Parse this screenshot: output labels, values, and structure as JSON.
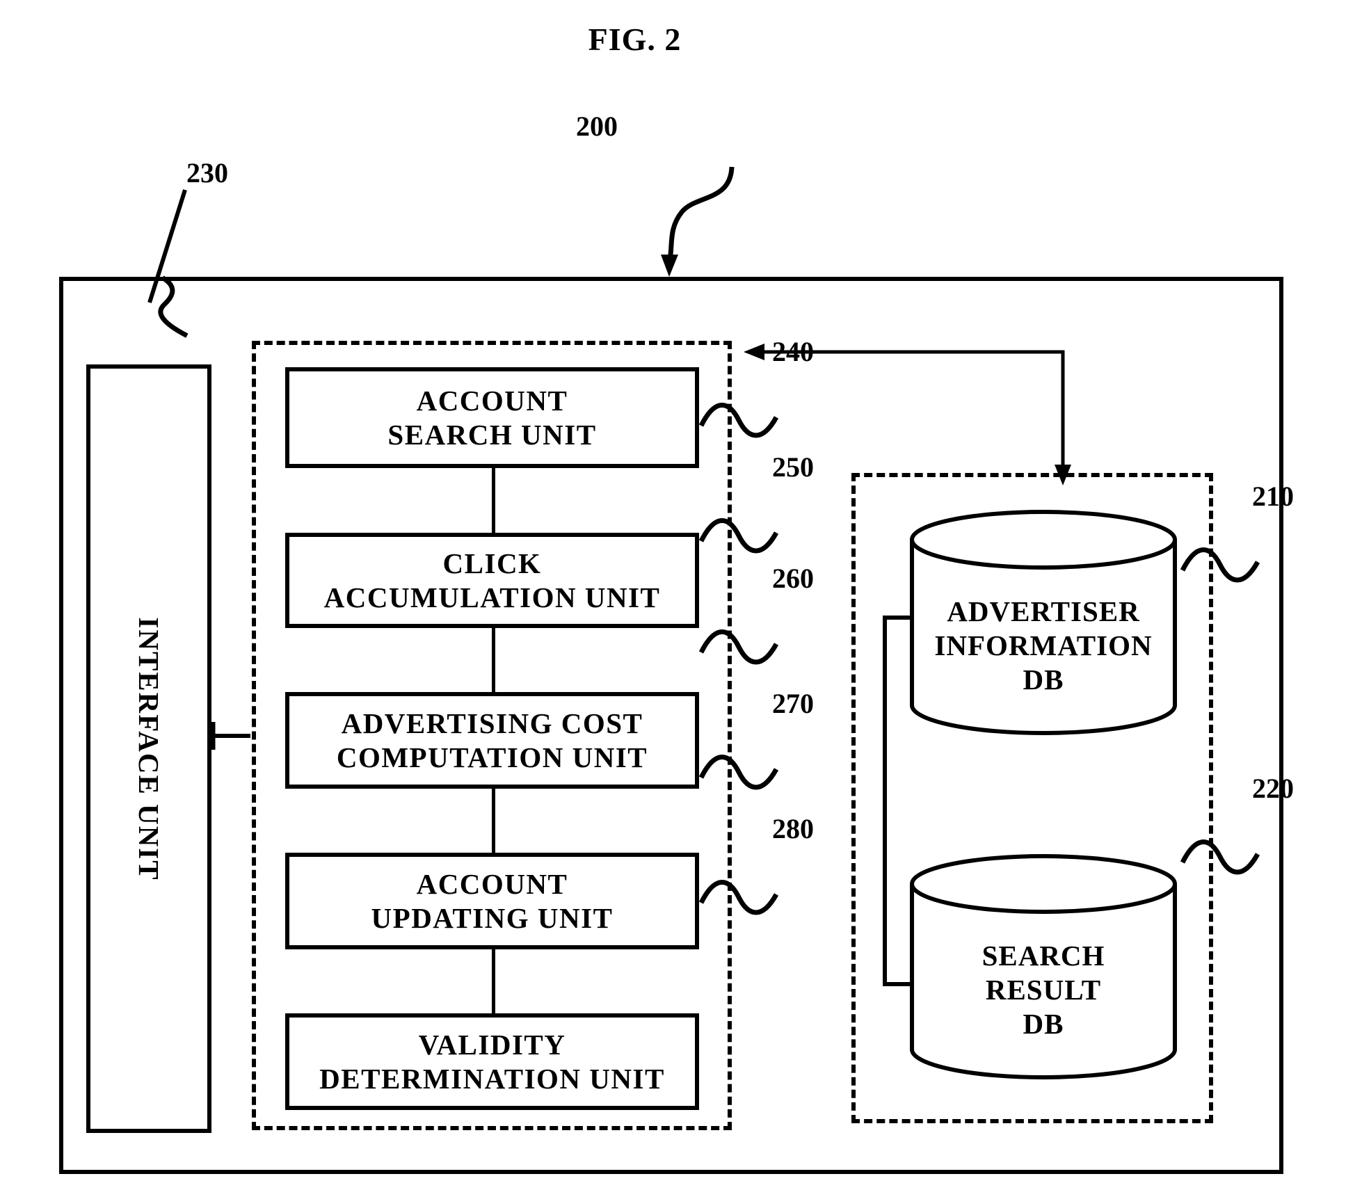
{
  "figure": {
    "title": "FIG. 2",
    "system_ref": "200"
  },
  "interface": {
    "ref": "230",
    "label": "INTERFACE UNIT"
  },
  "processing_units": [
    {
      "ref": "240",
      "lines": [
        "ACCOUNT",
        "SEARCH UNIT"
      ]
    },
    {
      "ref": "250",
      "lines": [
        "CLICK",
        "ACCUMULATION UNIT"
      ]
    },
    {
      "ref": "260",
      "lines": [
        "ADVERTISING COST",
        "COMPUTATION UNIT"
      ]
    },
    {
      "ref": "270",
      "lines": [
        "ACCOUNT",
        "UPDATING UNIT"
      ]
    },
    {
      "ref": "280",
      "lines": [
        "VALIDITY",
        "DETERMINATION UNIT"
      ]
    }
  ],
  "databases": [
    {
      "ref": "210",
      "lines": [
        "ADVERTISER",
        "INFORMATION",
        "DB"
      ]
    },
    {
      "ref": "220",
      "lines": [
        "SEARCH",
        "RESULT",
        "DB"
      ]
    }
  ]
}
